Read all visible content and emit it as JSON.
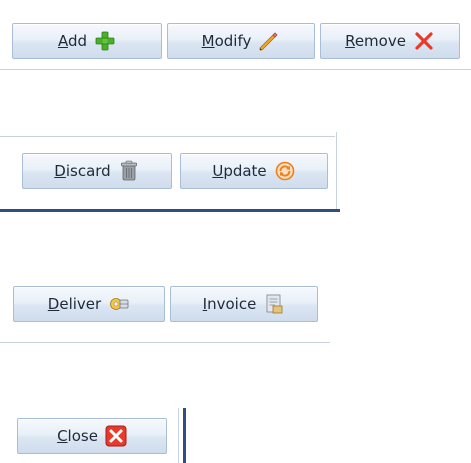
{
  "toolbar1": {
    "add": {
      "mnemonic": "A",
      "rest": "dd",
      "icon": "plus-icon"
    },
    "modify": {
      "mnemonic": "M",
      "rest": "odify",
      "icon": "pencil-icon"
    },
    "remove": {
      "mnemonic": "R",
      "rest": "emove",
      "icon": "x-icon"
    }
  },
  "toolbar2": {
    "discard": {
      "mnemonic": "D",
      "rest": "iscard",
      "icon": "trash-icon"
    },
    "update": {
      "mnemonic": "U",
      "rest": "pdate",
      "icon": "refresh-icon"
    }
  },
  "toolbar3": {
    "deliver": {
      "mnemonic": "D",
      "rest": "eliver",
      "icon": "delivery-icon"
    },
    "invoice": {
      "mnemonic": "I",
      "rest": "nvoice",
      "icon": "invoice-icon"
    }
  },
  "toolbar4": {
    "close": {
      "mnemonic": "C",
      "rest": "lose",
      "icon": "close-x-icon"
    }
  },
  "colors": {
    "plus_green": "#4caf2a",
    "x_red": "#e8392b",
    "accent_blue": "#2e4f86"
  }
}
